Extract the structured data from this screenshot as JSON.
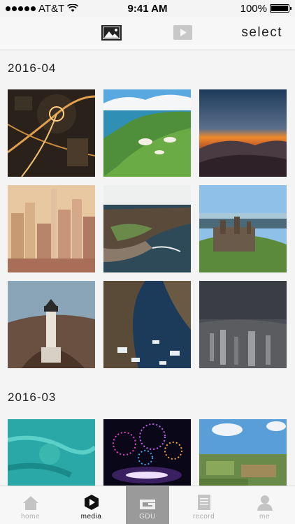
{
  "status_bar": {
    "carrier": "AT&T",
    "time": "9:41 AM",
    "battery": "100%",
    "battery_level": 1.0
  },
  "toolbar": {
    "select_label": "select",
    "photo_icon": "photo-icon",
    "video_icon": "video-icon"
  },
  "sections": [
    {
      "title": "2016-04"
    },
    {
      "title": "2016-03"
    }
  ],
  "tabs": [
    {
      "label": "home",
      "icon": "home-icon"
    },
    {
      "label": "media",
      "icon": "play-icon",
      "active": true
    },
    {
      "label": "GDU",
      "icon": "gdu-logo-icon"
    },
    {
      "label": "record",
      "icon": "document-icon"
    },
    {
      "label": "me",
      "icon": "person-icon"
    }
  ]
}
